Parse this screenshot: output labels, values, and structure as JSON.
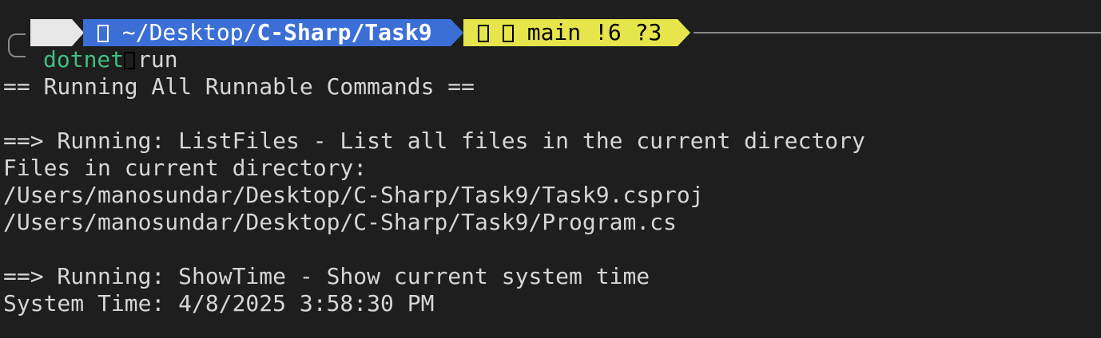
{
  "prompt": {
    "os_icon": "apple-icon",
    "dir_icon": "home-folder-icon",
    "path_prefix": "~/Desktop/",
    "path_bold": "C-Sharp/Task9",
    "git_icons": [
      "git-icon",
      "branch-icon"
    ],
    "branch": "main",
    "status": "!6 ?3"
  },
  "command": {
    "exe": "dotnet",
    "args": "run"
  },
  "output": [
    "== Running All Runnable Commands ==",
    "",
    "==> Running: ListFiles - List all files in the current directory",
    "Files in current directory:",
    "/Users/manosundar/Desktop/C-Sharp/Task9/Task9.csproj",
    "/Users/manosundar/Desktop/C-Sharp/Task9/Program.cs",
    "",
    "==> Running: ShowTime - Show current system time",
    "System Time: 4/8/2025 3:58:30 PM"
  ],
  "colors": {
    "background": "#1e1e1e",
    "text": "#d6d6d6",
    "command": "#3fbf7f",
    "segment_os": "#e8e8e8",
    "segment_dir": "#3b6fd6",
    "segment_git": "#e6e64c"
  }
}
